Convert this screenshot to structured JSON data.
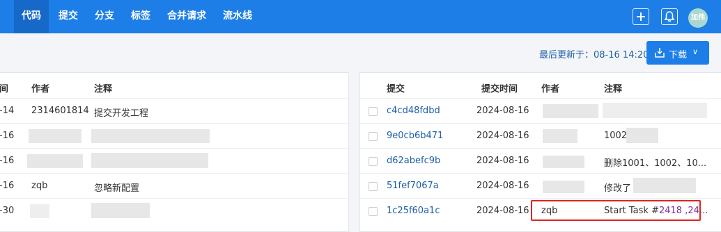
{
  "nav": {
    "tabs": [
      "代码",
      "提交",
      "分支",
      "标签",
      "合并请求",
      "流水线"
    ],
    "active_tab": "代码",
    "avatar_text": "加伟"
  },
  "toolbar": {
    "last_updated_label": "最后更新于：",
    "last_updated_value": "08-16 14:20",
    "download_label": "下载"
  },
  "left_table": {
    "headers": {
      "time": "间",
      "author": "作者",
      "comment": "注释"
    },
    "rows": [
      {
        "time": "-14",
        "author": "2314601814",
        "comment": "提交开发工程"
      },
      {
        "time": "-16",
        "author": "",
        "comment": ""
      },
      {
        "time": "-16",
        "author": "",
        "comment": ""
      },
      {
        "time": "-16",
        "author": "zqb",
        "comment": "忽略新配置"
      },
      {
        "time": "-30",
        "author": "",
        "comment": ""
      }
    ]
  },
  "right_table": {
    "headers": {
      "commit": "提交",
      "commit_time": "提交时间",
      "author": "作者",
      "comment": "注释"
    },
    "rows": [
      {
        "commit": "c4cd48fdbd",
        "time": "2024-08-16",
        "author": "",
        "comment": ""
      },
      {
        "commit": "9e0cb6b471",
        "time": "2024-08-16",
        "author": "",
        "comment": "1002"
      },
      {
        "commit": "d62abefc9b",
        "time": "2024-08-16",
        "author": "",
        "comment": "删除1001、1002、10..."
      },
      {
        "commit": "51fef7067a",
        "time": "2024-08-16",
        "author": "",
        "comment": "修改了"
      },
      {
        "commit": "1c25f60a1c",
        "time": "2024-08-16",
        "author": "zqb",
        "comment": "Start Task #",
        "comment_refs": "2418 ,24..."
      }
    ]
  }
}
